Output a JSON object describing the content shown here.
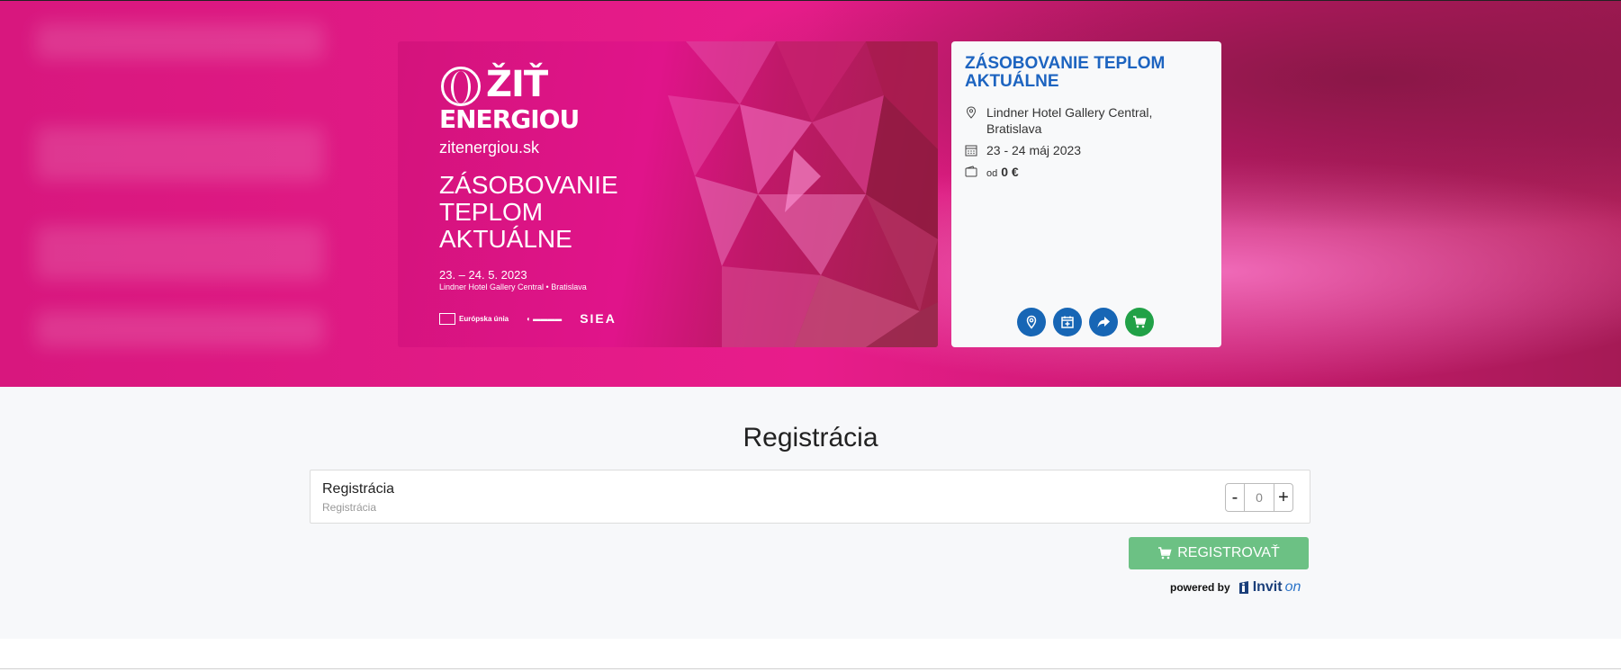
{
  "banner": {
    "logo_line1": "ŽIŤ",
    "logo_line2": "ENERGIOU",
    "site": "zitenergiou.sk",
    "title": "ZÁSOBOVANIE TEPLOM AKTUÁLNE",
    "dates": "23. – 24. 5. 2023",
    "venue": "Lindner Hotel Gallery Central • Bratislava",
    "partner_eu": "Európska únia",
    "partner_siea": "SIEA"
  },
  "event": {
    "title": "ZÁSOBOVANIE TEPLOM AKTUÁLNE",
    "location": "Lindner Hotel Gallery Central, Bratislava",
    "dates": "23 - 24  máj 2023",
    "price_prefix": "od",
    "price": "0 €",
    "accent_color": "#1d64c0"
  },
  "actions": [
    {
      "name": "location-button",
      "icon": "map-pin-icon"
    },
    {
      "name": "calendar-button",
      "icon": "calendar-add-icon"
    },
    {
      "name": "share-button",
      "icon": "share-icon"
    },
    {
      "name": "cart-button",
      "icon": "cart-icon"
    }
  ],
  "registration": {
    "heading": "Registrácia",
    "ticket_name": "Registrácia",
    "ticket_sub": "Registrácia",
    "quantity": "0",
    "minus_label": "-",
    "plus_label": "+",
    "submit_label": "REGISTROVAŤ",
    "submit_color": "#6cc184"
  },
  "powered": {
    "label": "powered by",
    "brand": "Invit",
    "brand_suffix": "on"
  }
}
